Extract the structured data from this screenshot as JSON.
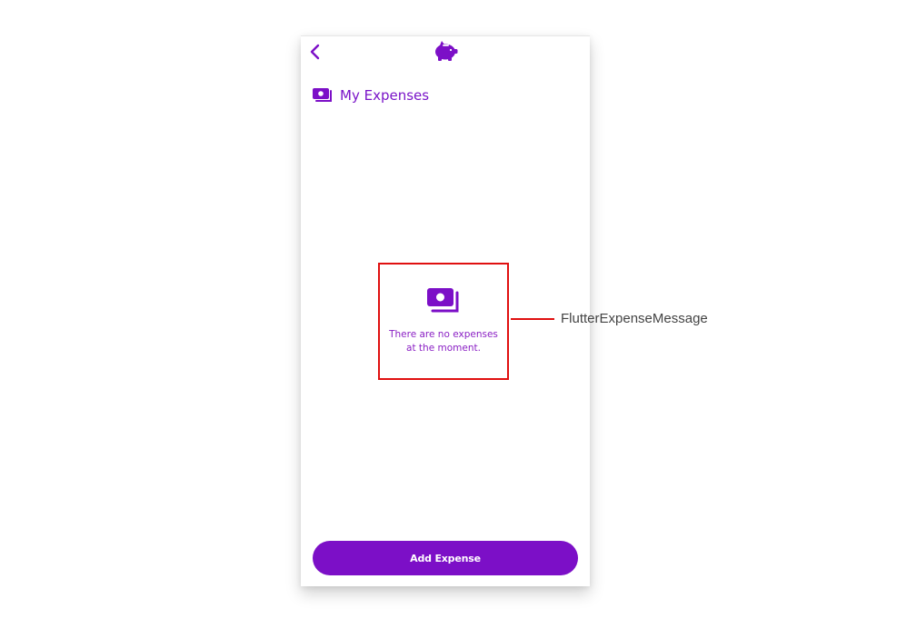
{
  "header": {
    "title": "My Expenses"
  },
  "empty_state": {
    "line1": "There are no expenses",
    "line2": "at the moment."
  },
  "actions": {
    "add_label": "Add Expense"
  },
  "annotation": {
    "label": "FlutterExpenseMessage"
  },
  "icons": {
    "back": "chevron-left-icon",
    "logo": "piggy-bank-icon",
    "expenses": "money-bills-icon"
  },
  "colors": {
    "primary": "#7c0fc7",
    "text_purple": "#8a1fc4",
    "annotation_red": "#e01010",
    "annotation_text": "#444444"
  }
}
